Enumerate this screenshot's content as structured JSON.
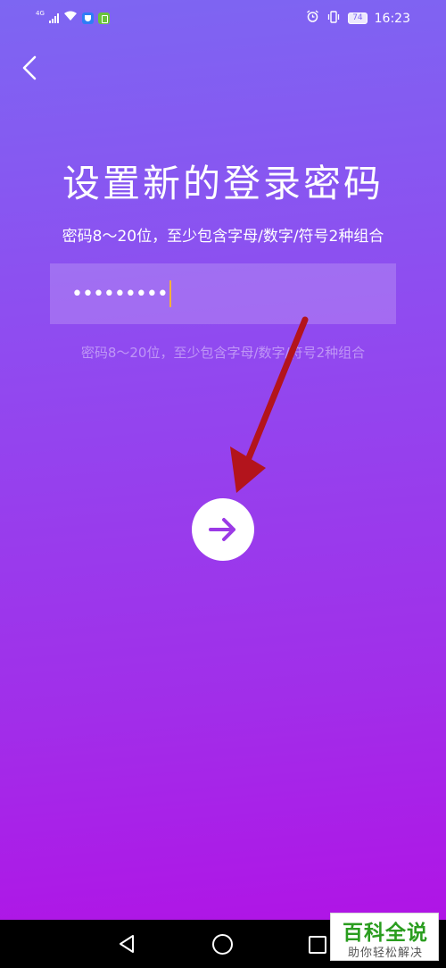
{
  "status_bar": {
    "network_label": "4G",
    "battery": "74",
    "time": "16:23"
  },
  "page": {
    "title": "设置新的登录密码",
    "subtitle": "密码8～20位，至少包含字母/数字/符号2种组合",
    "password_value": "•••••••••",
    "hint": "密码8～20位，至少包含字母/数字/符号2种组合"
  },
  "icons": {
    "back": "chevron-left-icon",
    "next": "arrow-right-icon"
  },
  "colors": {
    "gradient_top": "#7d66f2",
    "gradient_bottom": "#b014e6",
    "next_arrow": "#9b3ae6",
    "annotation_arrow": "#b3141c",
    "caret": "#f4b13c"
  },
  "watermark": {
    "main": "百科全说",
    "sub": "助你轻松解决"
  }
}
